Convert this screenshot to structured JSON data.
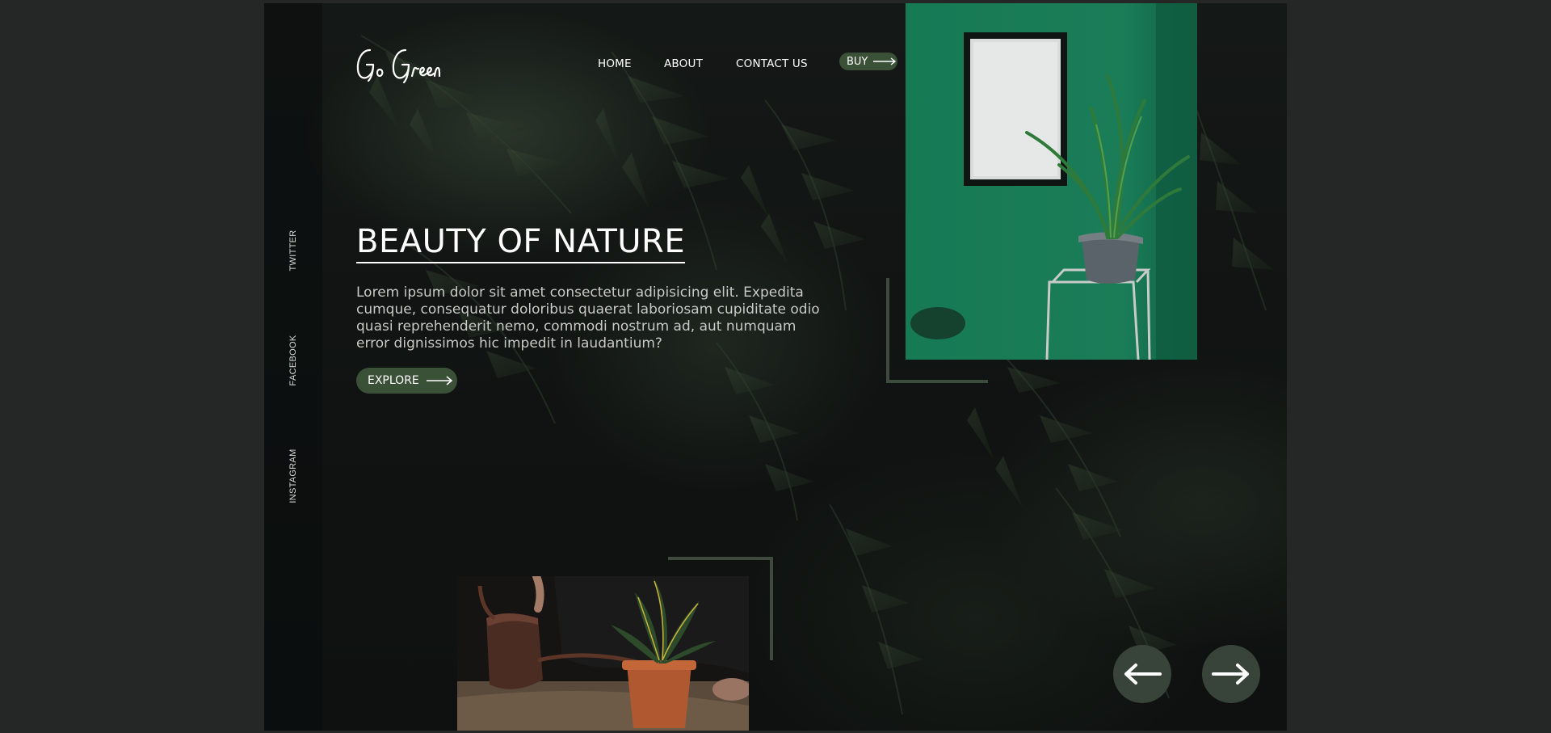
{
  "brand": {
    "logo_text": "Go Green"
  },
  "nav": {
    "home": "HOME",
    "about": "ABOUT",
    "contact": "CONTACT US",
    "buy": "BUY"
  },
  "social": {
    "twitter": "TWITTER",
    "facebook": "FACEBOOK",
    "instagram": "INSTAGRAM"
  },
  "hero": {
    "title": "BEAUTY OF NATURE",
    "body": "Lorem ipsum dolor sit amet consectetur adipisicing elit. Expedita cumque, consequatur doloribus quaerat laboriosam cupiditate odio quasi reprehenderit nemo, commodi nostrum ad, aut numquam error dignissimos hic impedit in laudantium?",
    "cta": "EXPLORE"
  },
  "icons": {
    "arrow": "arrow-right-icon",
    "prev": "arrow-left-icon",
    "next": "arrow-right-icon"
  },
  "colors": {
    "accent": "#3a5138",
    "background": "#101312",
    "outer": "#252727",
    "wall_green": "#1b7a57"
  }
}
